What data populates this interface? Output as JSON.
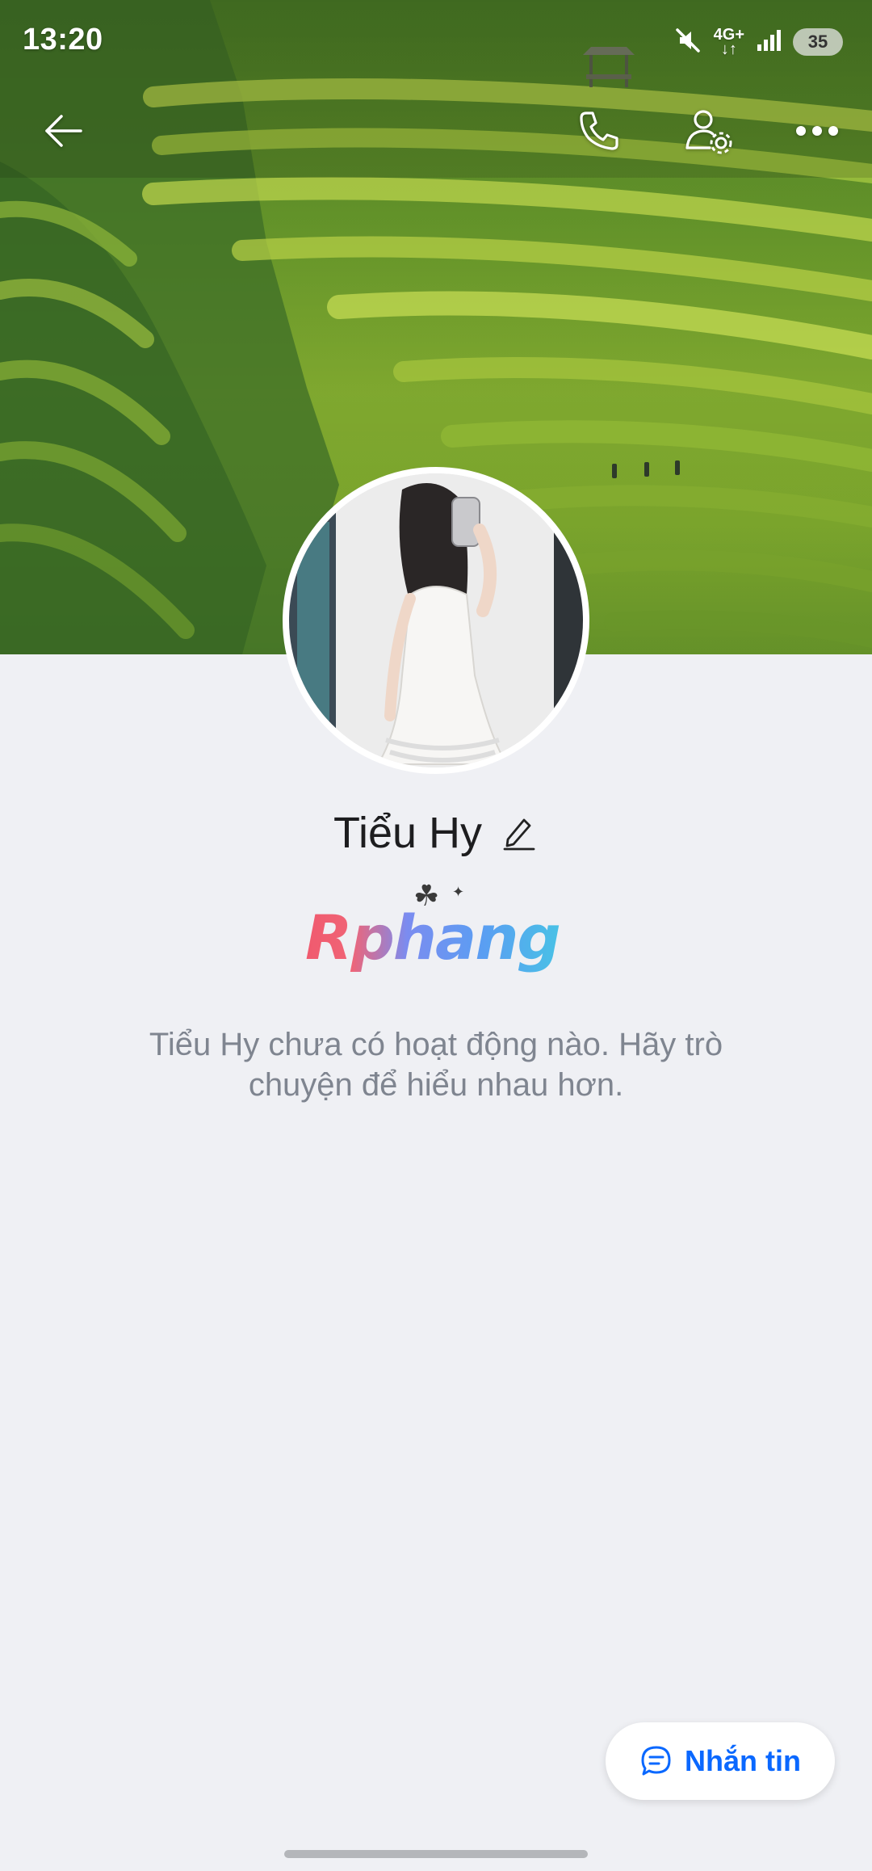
{
  "status_bar": {
    "time": "13:20",
    "network": "4G+",
    "battery": "35",
    "icons": [
      "mute-icon",
      "network-icon",
      "signal-icon",
      "battery-icon"
    ]
  },
  "nav": {
    "icons": [
      "back-arrow-icon",
      "phone-icon",
      "user-settings-icon",
      "more-icon"
    ]
  },
  "profile": {
    "name": "Tiểu Hy",
    "badge_text": "Rphang",
    "badge_deco": "☘",
    "empty_message": "Tiểu Hy chưa có hoạt động nào. Hãy trò chuyện để hiểu nhau hơn."
  },
  "actions": {
    "message_label": "Nhắn tin"
  },
  "colors": {
    "accent": "#0a68ff",
    "background": "#eff0f4",
    "muted_text": "#7f8590"
  }
}
